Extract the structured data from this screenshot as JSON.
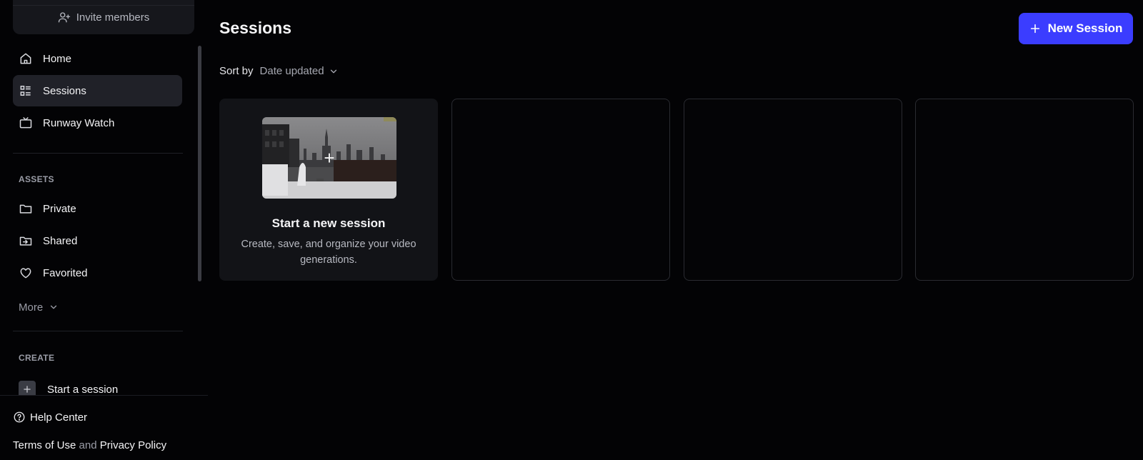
{
  "sidebar": {
    "invite_label": "Invite members",
    "nav": {
      "home": "Home",
      "sessions": "Sessions",
      "runway_watch": "Runway Watch"
    },
    "assets": {
      "label": "ASSETS",
      "private": "Private",
      "shared": "Shared",
      "favorited": "Favorited",
      "more": "More"
    },
    "create": {
      "label": "CREATE",
      "start_session": "Start a session"
    },
    "help_center": "Help Center",
    "legal": {
      "terms": "Terms of Use",
      "and": "and",
      "privacy": "Privacy Policy"
    }
  },
  "main": {
    "title": "Sessions",
    "new_session_label": "New Session",
    "sort_label": "Sort by",
    "sort_value": "Date updated",
    "new_card": {
      "title": "Start a new session",
      "description": "Create, save, and organize your video generations."
    }
  },
  "colors": {
    "background": "#030305",
    "accent": "#3b3dff",
    "active_item": "#202128"
  }
}
